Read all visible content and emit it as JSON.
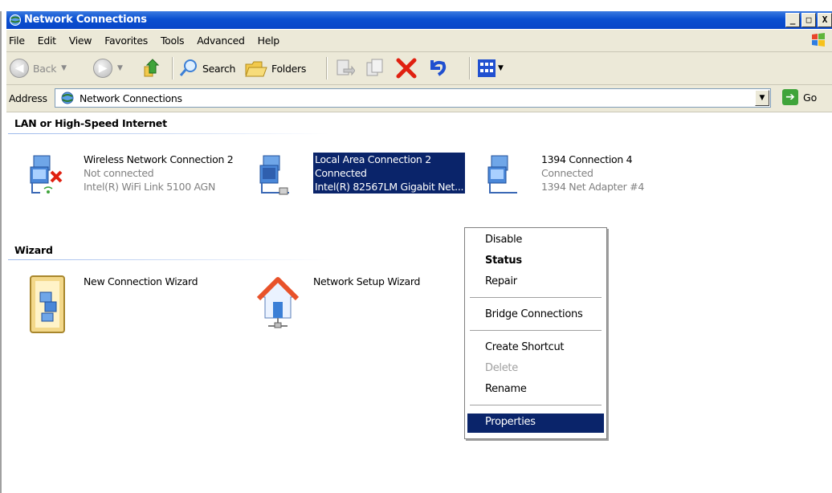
{
  "window": {
    "title": "Network Connections",
    "buttons": [
      "_",
      "□",
      "X"
    ]
  },
  "menubar": {
    "items": [
      "File",
      "Edit",
      "View",
      "Favorites",
      "Tools",
      "Advanced",
      "Help"
    ]
  },
  "toolbar": {
    "back_label": "Back",
    "search_label": "Search",
    "folders_label": "Folders"
  },
  "address": {
    "label": "Address",
    "value": "Network Connections",
    "go_label": "Go"
  },
  "groups": [
    {
      "title": "LAN or High-Speed Internet",
      "items": [
        {
          "name": "Wireless Network Connection 2",
          "status": "Not connected",
          "device": "Intel(R) WiFi Link 5100 AGN"
        },
        {
          "name": "Local Area Connection 2",
          "status": "Connected",
          "device": "Intel(R) 82567LM Gigabit Net..."
        },
        {
          "name": "1394 Connection 4",
          "status": "Connected",
          "device": "1394 Net Adapter #4"
        }
      ]
    },
    {
      "title": "Wizard",
      "items": [
        {
          "name": "New Connection Wizard"
        },
        {
          "name": "Network Setup Wizard"
        }
      ]
    }
  ],
  "context_menu": {
    "items": [
      "Disable",
      "Status",
      "Repair",
      "Bridge Connections",
      "Create Shortcut",
      "Delete",
      "Rename",
      "Properties"
    ]
  },
  "colors": {
    "title_bar": "#0a4fd0",
    "selection": "#0a246a",
    "chrome": "#ece9d8"
  }
}
